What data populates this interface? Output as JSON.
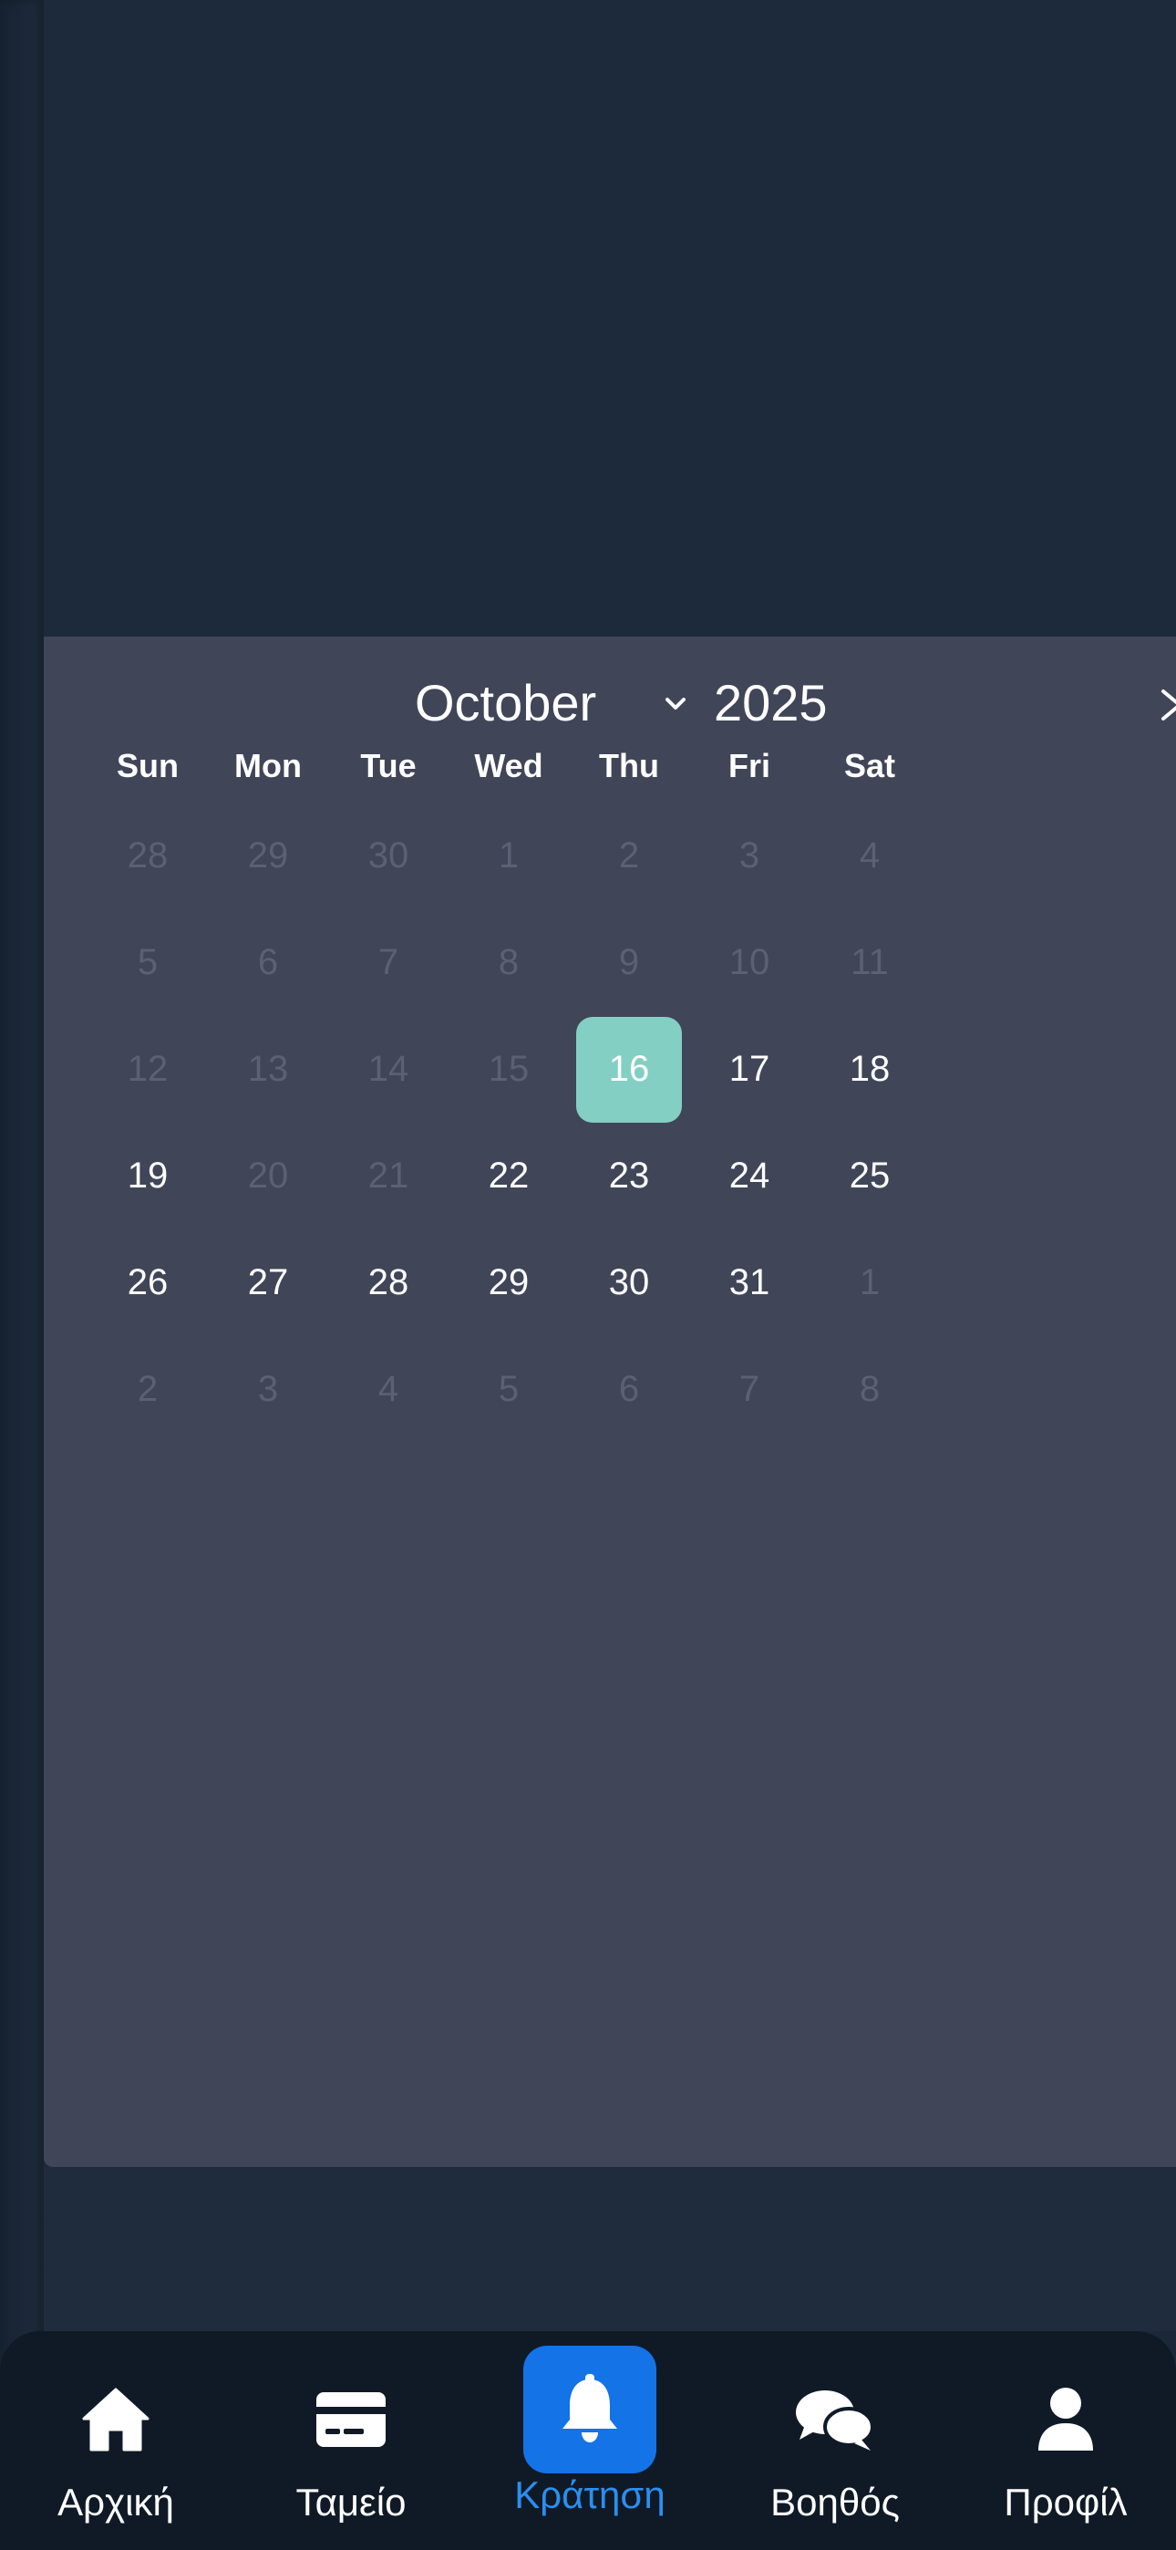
{
  "calendar": {
    "month": "October",
    "year": "2025",
    "weekdays": [
      "Sun",
      "Mon",
      "Tue",
      "Wed",
      "Thu",
      "Fri",
      "Sat"
    ],
    "selected_day": "16",
    "weeks": [
      [
        {
          "d": "28",
          "state": "inactive"
        },
        {
          "d": "29",
          "state": "inactive"
        },
        {
          "d": "30",
          "state": "inactive"
        },
        {
          "d": "1",
          "state": "inactive"
        },
        {
          "d": "2",
          "state": "inactive"
        },
        {
          "d": "3",
          "state": "inactive"
        },
        {
          "d": "4",
          "state": "inactive"
        }
      ],
      [
        {
          "d": "5",
          "state": "inactive"
        },
        {
          "d": "6",
          "state": "inactive"
        },
        {
          "d": "7",
          "state": "inactive"
        },
        {
          "d": "8",
          "state": "inactive"
        },
        {
          "d": "9",
          "state": "inactive"
        },
        {
          "d": "10",
          "state": "inactive"
        },
        {
          "d": "11",
          "state": "inactive"
        }
      ],
      [
        {
          "d": "12",
          "state": "inactive"
        },
        {
          "d": "13",
          "state": "inactive"
        },
        {
          "d": "14",
          "state": "inactive"
        },
        {
          "d": "15",
          "state": "inactive"
        },
        {
          "d": "16",
          "state": "selected"
        },
        {
          "d": "17",
          "state": "active"
        },
        {
          "d": "18",
          "state": "active"
        }
      ],
      [
        {
          "d": "19",
          "state": "active"
        },
        {
          "d": "20",
          "state": "inactive"
        },
        {
          "d": "21",
          "state": "inactive"
        },
        {
          "d": "22",
          "state": "active"
        },
        {
          "d": "23",
          "state": "active"
        },
        {
          "d": "24",
          "state": "active"
        },
        {
          "d": "25",
          "state": "active"
        }
      ],
      [
        {
          "d": "26",
          "state": "active"
        },
        {
          "d": "27",
          "state": "active"
        },
        {
          "d": "28",
          "state": "active"
        },
        {
          "d": "29",
          "state": "active"
        },
        {
          "d": "30",
          "state": "active"
        },
        {
          "d": "31",
          "state": "active"
        },
        {
          "d": "1",
          "state": "inactive"
        }
      ],
      [
        {
          "d": "2",
          "state": "inactive"
        },
        {
          "d": "3",
          "state": "inactive"
        },
        {
          "d": "4",
          "state": "inactive"
        },
        {
          "d": "5",
          "state": "inactive"
        },
        {
          "d": "6",
          "state": "inactive"
        },
        {
          "d": "7",
          "state": "inactive"
        },
        {
          "d": "8",
          "state": "inactive"
        }
      ]
    ]
  },
  "tabbar": {
    "items": [
      {
        "label": "Αρχική",
        "icon": "home-icon",
        "active": false
      },
      {
        "label": "Ταμείο",
        "icon": "credit-card-icon",
        "active": false
      },
      {
        "label": "Κράτηση",
        "icon": "bell-icon",
        "active": true
      },
      {
        "label": "Βοηθός",
        "icon": "chat-bubbles-icon",
        "active": false
      },
      {
        "label": "Προφίλ",
        "icon": "user-icon",
        "active": false
      }
    ]
  },
  "colors": {
    "panel": "#414558",
    "selected_day": "#84cfc4",
    "active_tab_bg": "#1473e6",
    "active_tab_label": "#2a8ff0",
    "tabbar_bg": "#101a27"
  }
}
